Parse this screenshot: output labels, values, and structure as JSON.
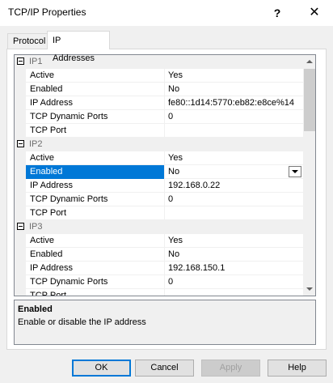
{
  "window": {
    "title": "TCP/IP Properties",
    "help_glyph": "?",
    "close_glyph": "✕"
  },
  "tabs": [
    {
      "label": "Protocol",
      "active": false
    },
    {
      "label": "IP Addresses",
      "active": true
    }
  ],
  "grid": {
    "categories": [
      {
        "label": "IP1",
        "rows": [
          {
            "name": "Active",
            "value": "Yes"
          },
          {
            "name": "Enabled",
            "value": "No"
          },
          {
            "name": "IP Address",
            "value": "fe80::1d14:5770:eb82:e8ce%14"
          },
          {
            "name": "TCP Dynamic Ports",
            "value": "0"
          },
          {
            "name": "TCP Port",
            "value": ""
          }
        ]
      },
      {
        "label": "IP2",
        "rows": [
          {
            "name": "Active",
            "value": "Yes"
          },
          {
            "name": "Enabled",
            "value": "No",
            "selected": true
          },
          {
            "name": "IP Address",
            "value": "192.168.0.22"
          },
          {
            "name": "TCP Dynamic Ports",
            "value": "0"
          },
          {
            "name": "TCP Port",
            "value": ""
          }
        ]
      },
      {
        "label": "IP3",
        "rows": [
          {
            "name": "Active",
            "value": "Yes"
          },
          {
            "name": "Enabled",
            "value": "No"
          },
          {
            "name": "IP Address",
            "value": "192.168.150.1"
          },
          {
            "name": "TCP Dynamic Ports",
            "value": "0"
          },
          {
            "name": "TCP Port",
            "value": ""
          }
        ]
      }
    ]
  },
  "description": {
    "title": "Enabled",
    "text": "Enable or disable the IP address"
  },
  "buttons": {
    "ok": "OK",
    "cancel": "Cancel",
    "apply": "Apply",
    "help": "Help"
  },
  "colors": {
    "selection": "#0078d7",
    "category_bg": "#f0f0f0"
  }
}
